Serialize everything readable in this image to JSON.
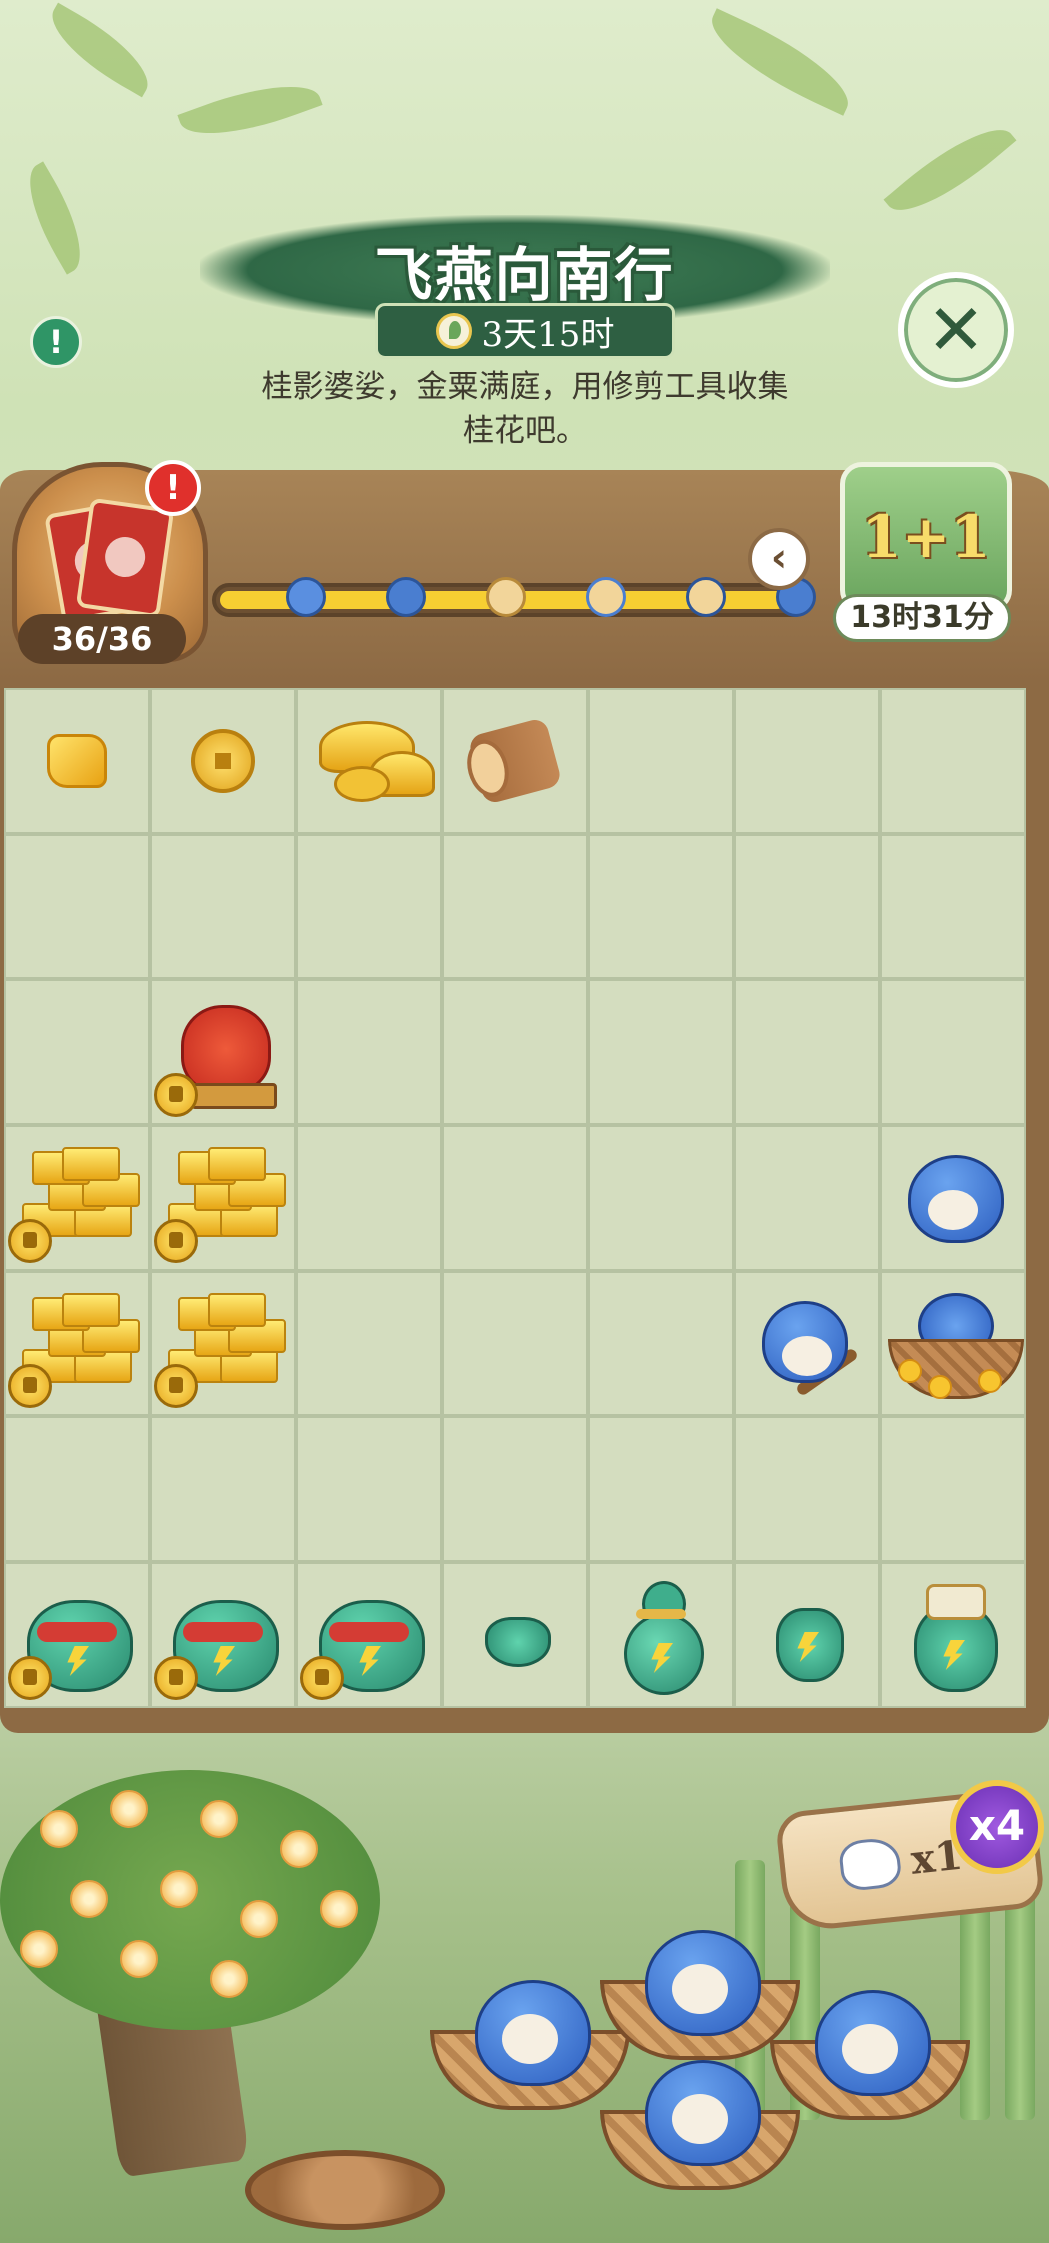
{
  "event": {
    "title": "飞燕向南行",
    "countdown": "3天15时",
    "description_line1": "桂影婆娑，金粟满庭，用修剪工具收集",
    "description_line2": "桂花吧。"
  },
  "header": {
    "info_label": "!",
    "close_label": "✕",
    "card_counter": "36/36",
    "alert_label": "!",
    "back_arrow": "‹"
  },
  "bonus": {
    "label": "1+1",
    "timer": "13时31分"
  },
  "progress": {
    "fraction": 0.97,
    "rewards": [
      "blue-feather",
      "blue-bird",
      "egg",
      "goggle-egg",
      "bird-egg",
      "bird"
    ]
  },
  "board": {
    "rows": 7,
    "columns": 7,
    "cells": [
      [
        "gold-nugget",
        "gold-coin",
        "gold-ingots",
        "wood-log",
        "",
        "",
        ""
      ],
      [
        "",
        "",
        "",
        "",
        "",
        "",
        ""
      ],
      [
        "",
        "red-lion-locked",
        "",
        "",
        "",
        "",
        ""
      ],
      [
        "gold-bars-locked",
        "gold-bars-locked",
        "",
        "",
        "",
        "",
        "blue-bird"
      ],
      [
        "gold-bars-locked",
        "gold-bars-locked",
        "",
        "",
        "",
        "blue-bird-branch",
        "bird-nest-flowers"
      ],
      [
        "",
        "",
        "",
        "",
        "",
        "",
        ""
      ],
      [
        "jar-locked",
        "jar-locked",
        "jar-locked",
        "small-cup",
        "gourd",
        "pouch",
        "urn"
      ]
    ]
  },
  "tool": {
    "count": "x1",
    "multiplier": "x4"
  },
  "colors": {
    "board_wood": "#8d6a44",
    "cell": "#d4ddbf",
    "accent_green": "#2f6846",
    "progress_fill": "#f7cf32"
  }
}
